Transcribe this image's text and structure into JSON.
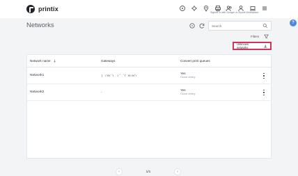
{
  "app": {
    "brand": "printix",
    "header_subtext": "Signed in with Google or Zlyuzit Workspace"
  },
  "header": {
    "icons": [
      "monitor-icon",
      "gear-icon",
      "location-pin-icon",
      "printer-icon",
      "users-icon",
      "user-icon",
      "laptop-icon",
      "menu-icon"
    ]
  },
  "page": {
    "title": "Networks"
  },
  "search": {
    "placeholder": "Search"
  },
  "filters": {
    "label": "Filters"
  },
  "unknown_networks": {
    "label": "Unknown networks"
  },
  "table": {
    "columns": {
      "name": "Network name",
      "gateways": "Gateways",
      "convert": "Convert print queues"
    },
    "rows": [
      {
        "name": "Network1",
        "gateways": "❘ ːı’ıɘː ˘ı ː ːı ˘ ː ˘ı’ ːɘıːɘı˘ı",
        "convert": "Yes",
        "convert_sub": "Global setting"
      },
      {
        "name": "Network2",
        "gateways": "-",
        "convert": "Yes",
        "convert_sub": "Global setting"
      }
    ]
  },
  "pagination": {
    "label": "1/1"
  },
  "help": {
    "label": "?"
  }
}
